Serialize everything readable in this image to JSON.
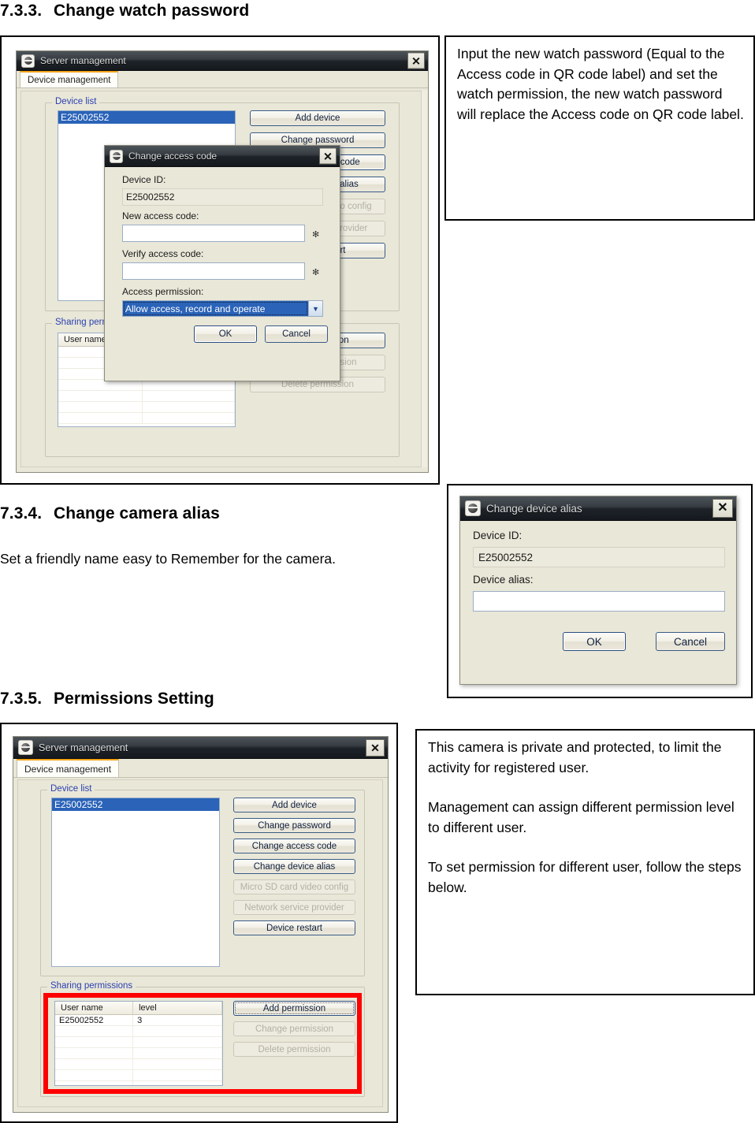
{
  "sections": {
    "s733": {
      "num": "7.3.3.",
      "title": "Change watch password"
    },
    "s734": {
      "num": "7.3.4.",
      "title": "Change camera alias",
      "body": "Set a friendly name easy to Remember for the camera."
    },
    "s735": {
      "num": "7.3.5.",
      "title": "Permissions Setting"
    }
  },
  "notes": {
    "watch_password": "Input the new watch password (Equal to the Access code in QR code label) and set the watch permission, the new watch password will replace the Access code on QR code label.",
    "permissions": [
      "This camera is private and protected, to limit the activity for registered user.",
      "Management can assign different permission level to different user.",
      "To set permission for different user, follow the steps below."
    ]
  },
  "server_window": {
    "title": "Server management",
    "close_label": "✕",
    "tab": "Device management",
    "device_list": {
      "group_label": "Device list",
      "selected_device": "E25002552"
    },
    "buttons": [
      {
        "label": "Add device",
        "enabled": true
      },
      {
        "label": "Change password",
        "enabled": true
      },
      {
        "label": "Change access code",
        "enabled": true
      },
      {
        "label": "Change device alias",
        "enabled": true
      },
      {
        "label": "Micro SD card video config",
        "enabled": false
      },
      {
        "label": "Network service provider",
        "enabled": false
      },
      {
        "label": "Device restart",
        "enabled": true
      }
    ],
    "sharing": {
      "group_label": "Sharing permissions",
      "columns": [
        "User name",
        "level"
      ],
      "rows": [
        [
          "E25002552",
          "3"
        ],
        [
          "",
          ""
        ],
        [
          "",
          ""
        ],
        [
          "",
          ""
        ],
        [
          "",
          ""
        ],
        [
          "",
          ""
        ],
        [
          "",
          ""
        ]
      ],
      "buttons": [
        {
          "label": "Add permission",
          "enabled": true
        },
        {
          "label": "Change permission",
          "enabled": false
        },
        {
          "label": "Delete permission",
          "enabled": false
        }
      ]
    }
  },
  "change_access_code_dialog": {
    "title": "Change access code",
    "close_label": "✕",
    "device_id_label": "Device ID:",
    "device_id_value": "E25002552",
    "new_code_label": "New access code:",
    "new_code_value": "",
    "verify_code_label": "Verify access code:",
    "verify_code_value": "",
    "required_marker": "✻",
    "permission_label": "Access permission:",
    "permission_value": "Allow access, record and operate",
    "dropdown_arrow": "▼",
    "ok_label": "OK",
    "cancel_label": "Cancel"
  },
  "change_device_alias_dialog": {
    "title": "Change device alias",
    "close_label": "✕",
    "device_id_label": "Device ID:",
    "device_id_value": "E25002552",
    "alias_label": "Device alias:",
    "alias_value": "",
    "ok_label": "OK",
    "cancel_label": "Cancel"
  },
  "colors": {
    "accent_blue": "#2a63b8",
    "group_label_blue": "#2a3fb0",
    "highlight_red": "#fe0000",
    "tab_orange": "#f3a41a",
    "window_bg": "#e9e7d8"
  }
}
